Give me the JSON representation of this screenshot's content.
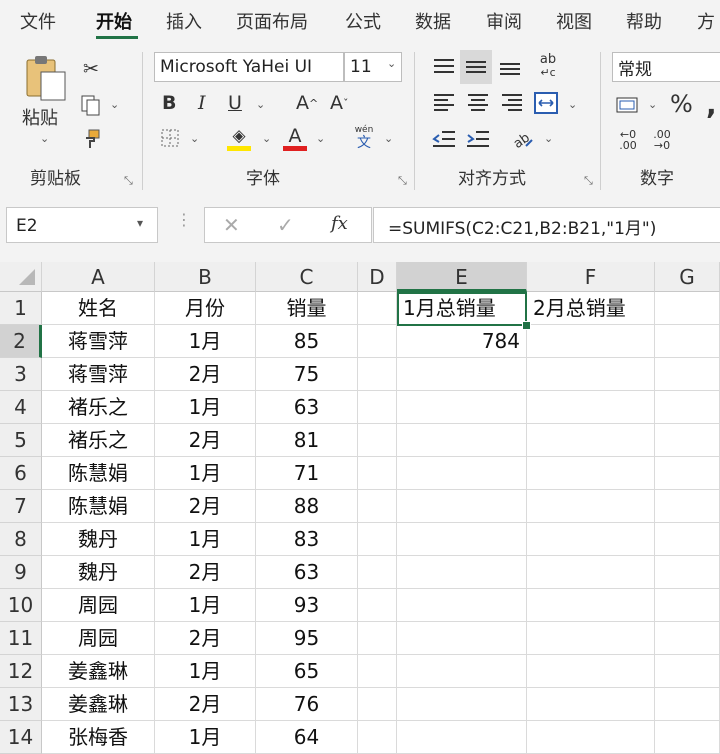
{
  "menu": {
    "tabs": [
      "文件",
      "开始",
      "插入",
      "页面布局",
      "公式",
      "数据",
      "审阅",
      "视图",
      "帮助",
      "方"
    ],
    "active_index": 1
  },
  "ribbon": {
    "clipboard": {
      "paste_label": "粘贴",
      "group_label": "剪贴板"
    },
    "font": {
      "font_name": "Microsoft YaHei UI",
      "font_size": "11",
      "group_label": "字体",
      "phonetic_label": "wén",
      "phonetic_char": "文",
      "bold": "B",
      "italic": "I",
      "underline": "U"
    },
    "alignment": {
      "group_label": "对齐方式",
      "wrap_icon_text": "ab"
    },
    "number": {
      "format": "常规",
      "group_label": "数字",
      "percent": "%"
    }
  },
  "formula_bar": {
    "name_box": "E2",
    "formula": "=SUMIFS(C2:C21,B2:B21,\"1月\")",
    "fx_label": "fx"
  },
  "sheet": {
    "columns": [
      "A",
      "B",
      "C",
      "D",
      "E",
      "F",
      "G"
    ],
    "row_numbers": [
      "1",
      "2",
      "3",
      "4",
      "5",
      "6",
      "7",
      "8",
      "9",
      "10",
      "11",
      "12",
      "13",
      "14"
    ],
    "headers": {
      "A": "姓名",
      "B": "月份",
      "C": "销量",
      "E": "1月总销量",
      "F": "2月总销量"
    },
    "rows": [
      [
        "蒋雪萍",
        "1月",
        "85"
      ],
      [
        "蒋雪萍",
        "2月",
        "75"
      ],
      [
        "褚乐之",
        "1月",
        "63"
      ],
      [
        "褚乐之",
        "2月",
        "81"
      ],
      [
        "陈慧娟",
        "1月",
        "71"
      ],
      [
        "陈慧娟",
        "2月",
        "88"
      ],
      [
        "魏丹",
        "1月",
        "83"
      ],
      [
        "魏丹",
        "2月",
        "63"
      ],
      [
        "周园",
        "1月",
        "93"
      ],
      [
        "周园",
        "2月",
        "95"
      ],
      [
        "姜鑫琳",
        "1月",
        "65"
      ],
      [
        "姜鑫琳",
        "2月",
        "76"
      ],
      [
        "张梅香",
        "1月",
        "64"
      ]
    ],
    "e2_value": "784",
    "selected_cell": "E2"
  },
  "colors": {
    "accent": "#217346",
    "font_color_bar": "#e02020",
    "highlight_bar": "#ffe600"
  }
}
